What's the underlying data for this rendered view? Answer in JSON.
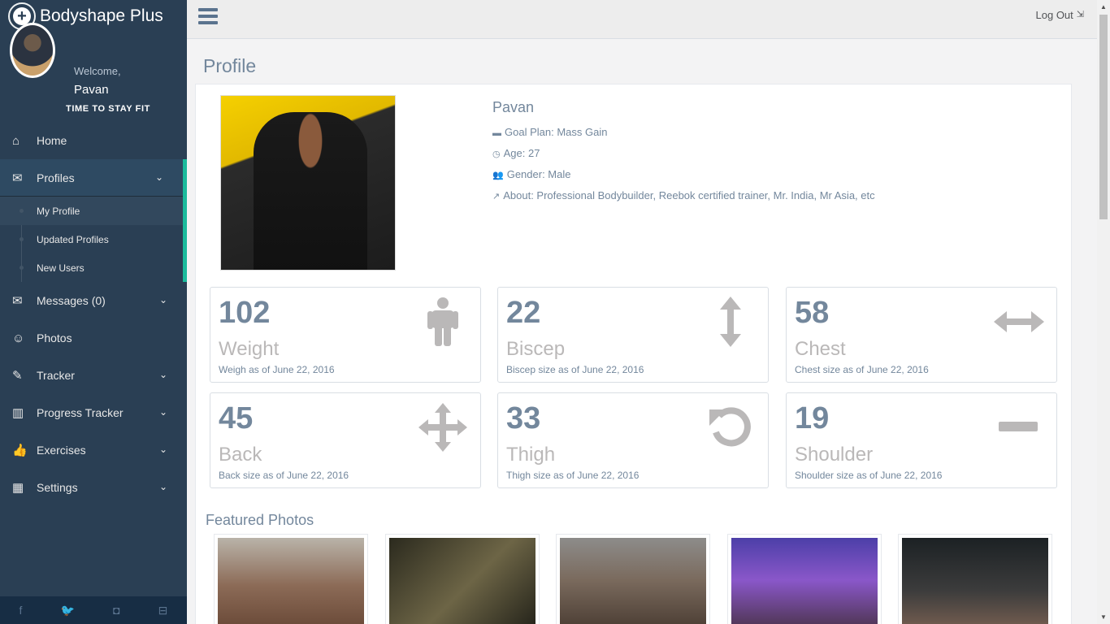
{
  "app": {
    "title": "Bodyshape Plus",
    "logo_glyph": "+"
  },
  "user": {
    "welcome": "Welcome,",
    "name": "Pavan",
    "tagline": "TIME TO STAY FIT"
  },
  "nav": {
    "home": "Home",
    "profiles": "Profiles",
    "profiles_sub": [
      "My Profile",
      "Updated Profiles",
      "New Users"
    ],
    "messages": "Messages (0)",
    "photos": "Photos",
    "tracker": "Tracker",
    "progress_tracker": "Progress Tracker",
    "exercises": "Exercises",
    "settings": "Settings"
  },
  "icons": {
    "home": "⌂",
    "profiles": "✉",
    "messages": "✉",
    "photos": "☺",
    "tracker": "✎",
    "progress": "▥",
    "exercises": "👍",
    "settings": "▦",
    "chevron": "⌄",
    "facebook": "f",
    "twitter": "🐦",
    "instagram": "◘",
    "inbox": "⊟",
    "logout": "⇲",
    "briefcase": "▬",
    "clock": "◷",
    "users": "👥",
    "external": "↗"
  },
  "topbar": {
    "logout": "Log Out"
  },
  "page": {
    "title": "Profile"
  },
  "profile": {
    "name": "Pavan",
    "goal": "Goal Plan: Mass Gain",
    "age": "Age: 27",
    "gender": "Gender: Male",
    "about": "About: Professional Bodybuilder, Reebok certified trainer, Mr. India, Mr Asia, etc"
  },
  "stats": [
    {
      "value": "102",
      "label": "Weight",
      "sub": "Weigh as of June 22, 2016",
      "icon": "person"
    },
    {
      "value": "22",
      "label": "Biscep",
      "sub": "Biscep size as of June 22, 2016",
      "icon": "arrows-vertical"
    },
    {
      "value": "58",
      "label": "Chest",
      "sub": "Chest size as of June 22, 2016",
      "icon": "arrows-horizontal"
    },
    {
      "value": "45",
      "label": "Back",
      "sub": "Back size as of June 22, 2016",
      "icon": "arrows-all"
    },
    {
      "value": "33",
      "label": "Thigh",
      "sub": "Thigh size as of June 22, 2016",
      "icon": "undo"
    },
    {
      "value": "19",
      "label": "Shoulder",
      "sub": "Shoulder size as of June 22, 2016",
      "icon": "minus"
    }
  ],
  "featured": {
    "title": "Featured Photos"
  },
  "colors": {
    "sidebar": "#2a3f54",
    "accent": "#1abb9c",
    "text": "#73879c",
    "icon_grey": "#bab8b8"
  }
}
